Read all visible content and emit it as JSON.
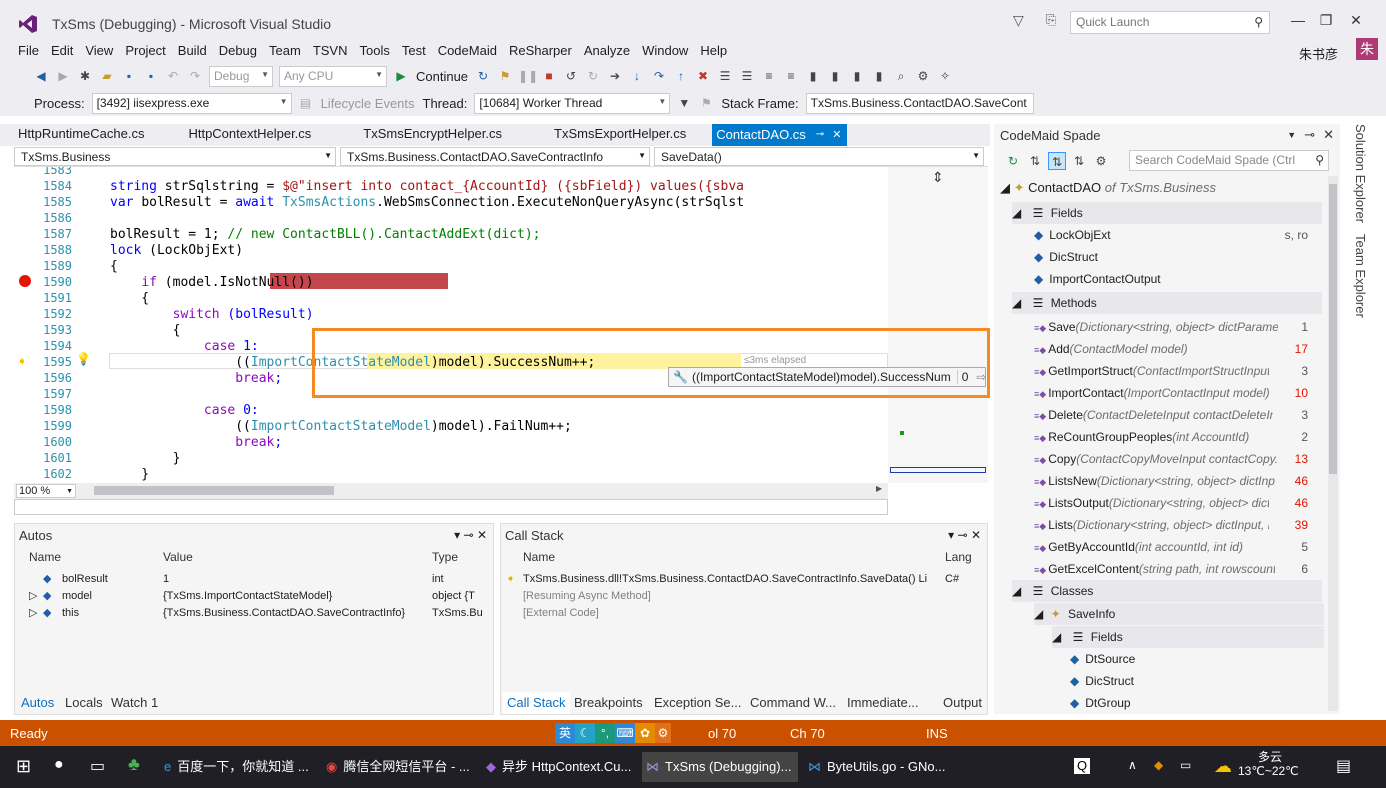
{
  "title": "TxSms (Debugging) - Microsoft Visual Studio",
  "quick_launch": {
    "placeholder": "Quick Launch"
  },
  "user": {
    "name": "朱书彦",
    "avatar_text": "朱"
  },
  "menu": [
    "File",
    "Edit",
    "View",
    "Project",
    "Build",
    "Debug",
    "Team",
    "TSVN",
    "Tools",
    "Test",
    "CodeMaid",
    "ReSharper",
    "Analyze",
    "Window",
    "Help"
  ],
  "toolbar": {
    "config": "Debug",
    "platform": "Any CPU",
    "continue_label": "Continue"
  },
  "debug_bar": {
    "process_label": "Process:",
    "process_value": "[3492] iisexpress.exe",
    "lifecycle_label": "Lifecycle Events",
    "thread_label": "Thread:",
    "thread_value": "[10684] Worker Thread",
    "stack_frame_label": "Stack Frame:",
    "stack_frame_value": "TxSms.Business.ContactDAO.SaveCont"
  },
  "doc_tabs": [
    "HttpRuntimeCache.cs",
    "HttpContextHelper.cs",
    "TxSmsEncryptHelper.cs",
    "TxSmsExportHelper.cs",
    "ContactDAO.cs"
  ],
  "navbar": {
    "project": "TxSms.Business",
    "type": "TxSms.Business.ContactDAO.SaveContractInfo",
    "member": "SaveData()"
  },
  "editor": {
    "lines": [
      {
        "n": "1583",
        "t": ""
      },
      {
        "n": "1584",
        "t": "string strSqlstring = $@\"insert into contact_{AccountId} ({sbField}) values({sbva"
      },
      {
        "n": "1585",
        "t": "var bolResult = await TxSmsActions.WebSmsConnection.ExecuteNonQueryAsync(strSqlst"
      },
      {
        "n": "1586",
        "t": ""
      },
      {
        "n": "1587",
        "t": "bolResult = 1; // new ContactBLL().CantactAddExt(dict);"
      },
      {
        "n": "1588",
        "t": "lock (LockObjExt)"
      },
      {
        "n": "1589",
        "t": "{"
      },
      {
        "n": "1590",
        "t": "    if (model.IsNotNull())"
      },
      {
        "n": "1591",
        "t": "    {"
      },
      {
        "n": "1592",
        "t": "        switch (bolResult)"
      },
      {
        "n": "1593",
        "t": "        {"
      },
      {
        "n": "1594",
        "t": "            case 1:"
      },
      {
        "n": "1595",
        "t": "                ((ImportContactStateModel)model).SuccessNum++;"
      },
      {
        "n": "1596",
        "t": "                break;"
      },
      {
        "n": "1597",
        "t": ""
      },
      {
        "n": "1598",
        "t": "            case 0:"
      },
      {
        "n": "1599",
        "t": "                ((ImportContactStateModel)model).FailNum++;"
      },
      {
        "n": "1600",
        "t": "                break;"
      },
      {
        "n": "1601",
        "t": "        }"
      },
      {
        "n": "1602",
        "t": "    }"
      }
    ],
    "elapsed": "≤3ms elapsed",
    "datatip_expr": "((ImportContactStateModel)model).SuccessNum",
    "datatip_value": "0",
    "zoom": "100 %"
  },
  "spade": {
    "title": "CodeMaid Spade",
    "search_placeholder": "Search CodeMaid Spade (Ctrl",
    "root": {
      "name": "ContactDAO",
      "ns": "of TxSms.Business"
    },
    "fields_label": "Fields",
    "fields": [
      {
        "name": "LockObjExt",
        "flags": "s, ro"
      },
      {
        "name": "DicStruct",
        "flags": ""
      },
      {
        "name": "ImportContactOutput",
        "flags": ""
      }
    ],
    "methods_label": "Methods",
    "methods": [
      {
        "name": "Save",
        "sig": "(Dictionary<string, object> dictParamet...",
        "count": "1",
        "red": false
      },
      {
        "name": "Add",
        "sig": "(ContactModel model)",
        "count": "17",
        "red": true
      },
      {
        "name": "GetImportStruct",
        "sig": "(ContactImportStructInput m...",
        "count": "3",
        "red": false
      },
      {
        "name": "ImportContact",
        "sig": "(ImportContactInput model)",
        "count": "10",
        "red": true
      },
      {
        "name": "Delete",
        "sig": "(ContactDeleteInput contactDeleteInp...",
        "count": "3",
        "red": false
      },
      {
        "name": "ReCountGroupPeoples",
        "sig": "(int AccountId)",
        "count": "2",
        "red": false
      },
      {
        "name": "Copy",
        "sig": "(ContactCopyMoveInput contactCopy...",
        "count": "13",
        "red": true
      },
      {
        "name": "ListsNew",
        "sig": "(Dictionary<string, object> dictInp...",
        "count": "46",
        "red": true
      },
      {
        "name": "ListsOutput",
        "sig": "(Dictionary<string, object> dictl...",
        "count": "46",
        "red": true
      },
      {
        "name": "Lists",
        "sig": "(Dictionary<string, object> dictInput, D...",
        "count": "39",
        "red": true
      },
      {
        "name": "GetByAccountId",
        "sig": "(int accountId, int id)",
        "count": "5",
        "red": false
      },
      {
        "name": "GetExcelContent",
        "sig": "(string path, int rowscount)",
        "count": "6",
        "red": false
      }
    ],
    "classes_label": "Classes",
    "class_name": "SaveInfo",
    "class_fields_label": "Fields",
    "class_fields": [
      "DtSource",
      "DicStruct",
      "DtGroup"
    ]
  },
  "side_tabs": [
    "Solution Explorer",
    "Team Explorer"
  ],
  "autos": {
    "title": "Autos",
    "headers": [
      "Name",
      "Value",
      "Type"
    ],
    "rows": [
      {
        "name": "bolResult",
        "value": "1",
        "type": "int"
      },
      {
        "name": "model",
        "value": "{TxSms.ImportContactStateModel}",
        "type": "object {T"
      },
      {
        "name": "this",
        "value": "{TxSms.Business.ContactDAO.SaveContractInfo}",
        "type": "TxSms.Bu"
      }
    ],
    "tabs": [
      "Autos",
      "Locals",
      "Watch 1"
    ]
  },
  "callstack": {
    "title": "Call Stack",
    "headers": [
      "Name",
      "Lang"
    ],
    "rows": [
      {
        "name": "TxSms.Business.dll!TxSms.Business.ContactDAO.SaveContractInfo.SaveData() Li",
        "lang": "C#"
      },
      {
        "name": "[Resuming Async Method]",
        "lang": ""
      },
      {
        "name": "[External Code]",
        "lang": ""
      }
    ],
    "tabs": [
      "Call Stack",
      "Breakpoints",
      "Exception Se...",
      "Command W...",
      "Immediate...",
      "Output"
    ]
  },
  "status": {
    "ready": "Ready",
    "col": "ol 70",
    "ch": "Ch 70",
    "ins": "INS",
    "ime": "英"
  },
  "taskbar": {
    "items": [
      "百度一下，你就知道 ...",
      "腾信全网短信平台 - ...",
      "异步 HttpContext.Cu...",
      "TxSms (Debugging)...",
      "ByteUtils.go - GNo..."
    ],
    "weather": "多云",
    "temp": "13℃~22℃"
  },
  "colors": {
    "accent": "#007acc",
    "status_bar": "#ca5100",
    "breakpoint": "#e51400",
    "highlight": "#f58a20"
  }
}
